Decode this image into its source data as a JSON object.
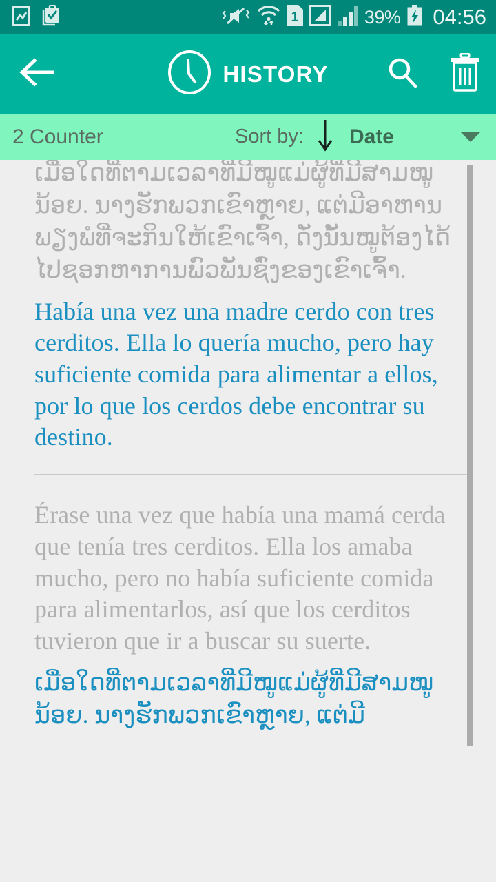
{
  "status_bar": {
    "background": "#00877a",
    "icons_left": [
      "image-icon",
      "clipboard-check-icon"
    ],
    "icons_right": [
      "mute-vibrate-icon",
      "wifi-icon",
      "sim-1-icon",
      "signal-bars-1-icon",
      "signal-bars-2-icon"
    ],
    "battery_percent": "39%",
    "battery_icon": "battery-charging-icon",
    "clock": "04:56"
  },
  "app_bar": {
    "background": "#00b39c",
    "back_icon": "arrow-back-icon",
    "clock_icon": "clock-icon",
    "title": "HISTORY",
    "search_icon": "search-icon",
    "delete_icon": "trash-icon"
  },
  "sort_bar": {
    "background": "#80f5bd",
    "counter": "2 Counter",
    "sort_by_label": "Sort by:",
    "sort_direction_icon": "arrow-down-icon",
    "sort_value": "Date",
    "dropdown_icon": "caret-down-icon"
  },
  "history": {
    "entries": [
      {
        "source_text": "ເມື່ອໃດທີ່ຕາມເວລາທີ່ມີໝູແມ່ຜູ້ທີ່ມີສາມໝູນ້ອຍ. ນາງຮັກພວກເຂົາຫຼາຍ, ແຕ່ມີອາຫານພຽງພໍທີ່ຈະກິນໃຫ້ເຂົາເຈົ້າ, ດັ່ງນັ້ນໝູຕ້ອງໄດ້ໄປຊອກຫາການພົວພັນຊົ່ງຂອງເຂົາເຈົ້າ.",
        "target_text": "Había una vez una madre cerdo con tres cerditos. Ella lo quería mucho, pero hay suficiente comida para alimentar a ellos, por lo que los cerdos debe encontrar su destino."
      },
      {
        "source_text": "Érase una vez que había una mamá cerda que tenía tres cerditos. Ella los amaba mucho, pero no había suficiente comida para alimentarlos, así que los cerditos tuvieron que ir a buscar su suerte.",
        "target_text": "ເມື່ອໃດທີ່ຕາມເວລາທີ່ມີໝູແມ່ຜູ້ທີ່ມີສາມໝູນ້ອຍ. ນາງຮັກພວກເຂົາຫຼາຍ, ແຕ່ມີ"
      }
    ]
  },
  "colors": {
    "status_bar": "#00877a",
    "app_bar": "#00b39c",
    "sort_bar": "#80f5bd",
    "content_bg": "#eeeeee",
    "source_text": "#b0b0b0",
    "target_text": "#1b8fc0",
    "scrollbar": "#ababab"
  },
  "scrollbar": {
    "name": "vertical-scrollbar"
  }
}
